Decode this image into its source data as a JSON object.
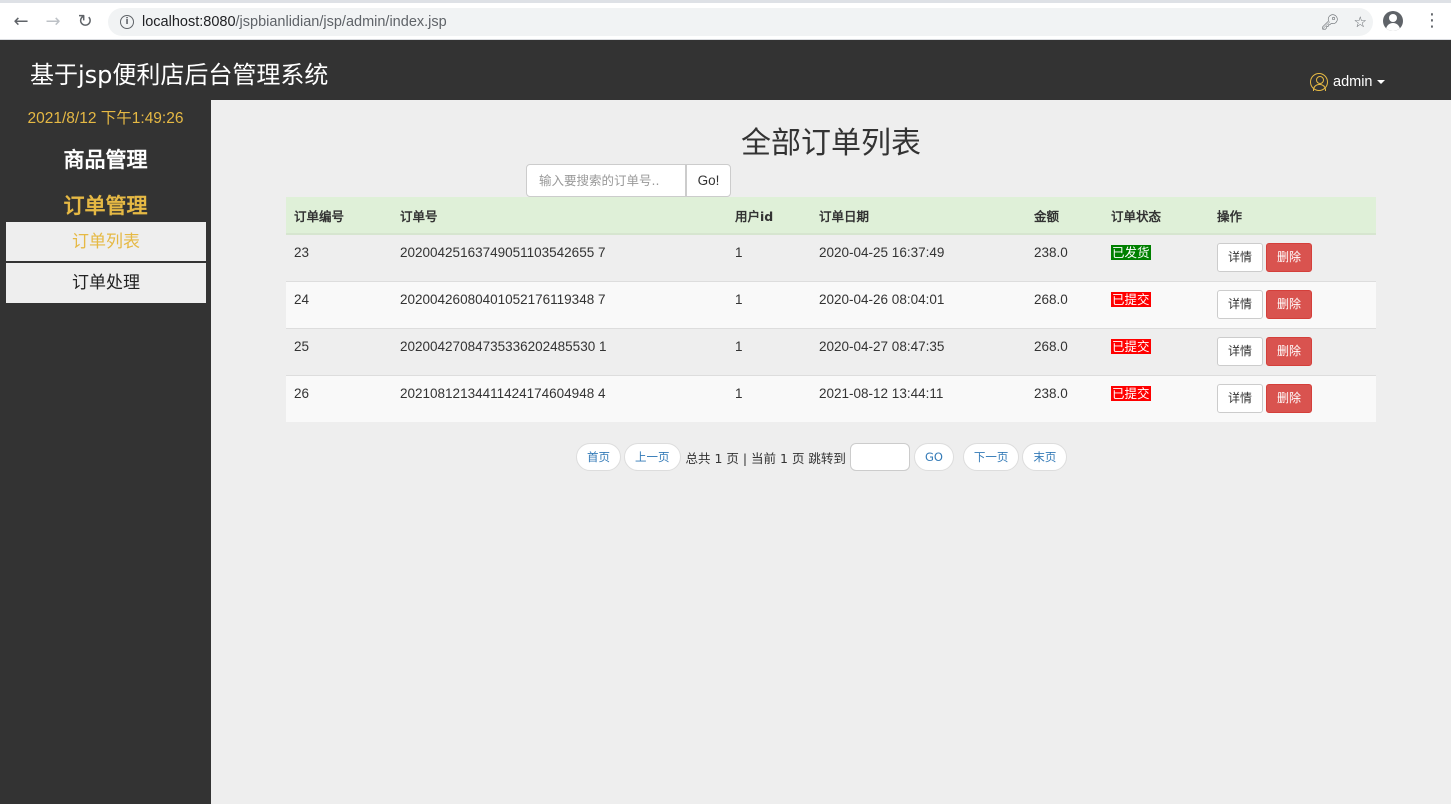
{
  "browser": {
    "url_host": "localhost:8080",
    "url_path": "/jspbianlidian/jsp/admin/index.jsp"
  },
  "header": {
    "title": "基于jsp便利店后台管理系统",
    "user": "admin"
  },
  "sidebar": {
    "clock": "2021/8/12 下午1:49:26",
    "goods_label": "商品管理",
    "orders_label": "订单管理",
    "items": [
      {
        "label": "订单列表",
        "active": true
      },
      {
        "label": "订单处理",
        "active": false
      }
    ]
  },
  "main": {
    "title": "全部订单列表",
    "search": {
      "placeholder": "输入要搜索的订单号..",
      "button": "Go!"
    },
    "columns": [
      "订单编号",
      "订单号",
      "用户id",
      "订单日期",
      "金额",
      "订单状态",
      "操作"
    ],
    "rows": [
      {
        "id": "23",
        "order_no": "20200425163749051103542655 7",
        "user_id": "1",
        "date": "2020-04-25 16:37:49",
        "amount": "238.0",
        "status": "已发货"
      },
      {
        "id": "24",
        "order_no": "20200426080401052176119348 7",
        "user_id": "1",
        "date": "2020-04-26 08:04:01",
        "amount": "268.0",
        "status": "已提交"
      },
      {
        "id": "25",
        "order_no": "20200427084735336202485530 1",
        "user_id": "1",
        "date": "2020-04-27 08:47:35",
        "amount": "268.0",
        "status": "已提交"
      },
      {
        "id": "26",
        "order_no": "20210812134411424174604948 4",
        "user_id": "1",
        "date": "2021-08-12 13:44:11",
        "amount": "238.0",
        "status": "已提交"
      }
    ],
    "detail_label": "详情",
    "delete_label": "删除",
    "colors": {
      "shipped": "#008000",
      "submitted": "#ff0000",
      "header_row": "#dff0d8",
      "accent": "#e6b944"
    }
  },
  "pager": {
    "first": "首页",
    "prev": "上一页",
    "info": "总共 1 页 | 当前 1 页 跳转到",
    "go": "GO",
    "next": "下一页",
    "last": "末页"
  }
}
